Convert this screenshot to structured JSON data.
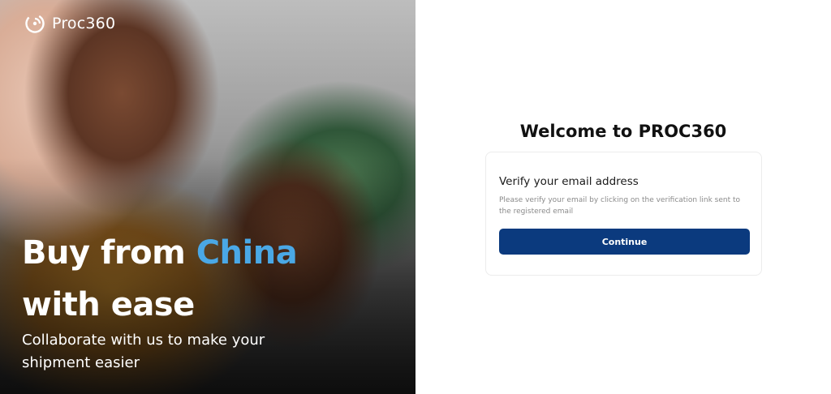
{
  "brand": {
    "logo_text": "Proc360",
    "logo_icon": "circle-arc-logo-icon"
  },
  "hero": {
    "headline_part1": "Buy from ",
    "headline_accent": "China",
    "headline_part2": "with ease",
    "subline": "Collaborate with us to make your shipment easier",
    "accent_color": "#4aa8e6"
  },
  "main": {
    "welcome_title": "Welcome to PROC360",
    "card": {
      "title": "Verify your email address",
      "description": "Please verify your email by clicking on the verification link sent to the registered email",
      "continue_label": "Continue",
      "button_color": "#0b3a7e"
    }
  }
}
